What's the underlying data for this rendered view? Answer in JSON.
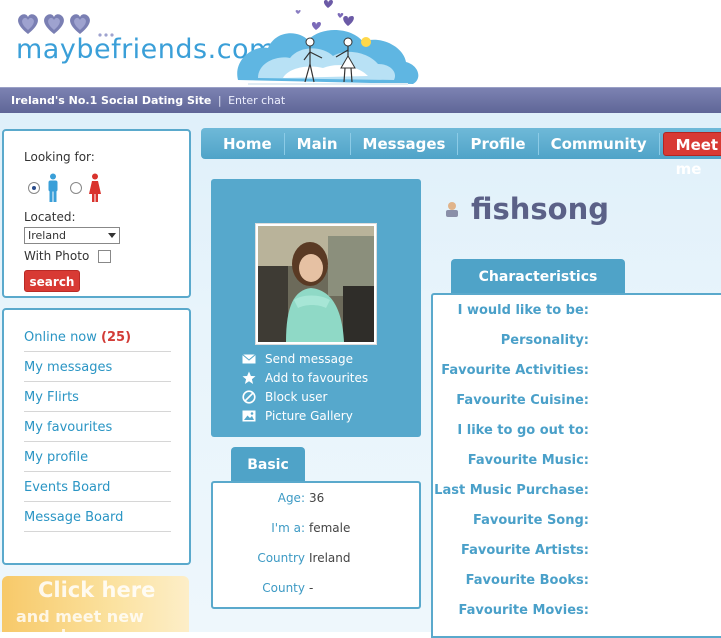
{
  "brand": {
    "logo_text": "maybefriends.com",
    "tagline": "Ireland's No.1 Social Dating Site",
    "separator": "|",
    "enter_chat": "Enter chat"
  },
  "search": {
    "looking_for_label": "Looking for:",
    "selected_gender": "male",
    "located_label": "Located:",
    "located_value": "Ireland",
    "with_photo_label": "With Photo",
    "with_photo_checked": false,
    "search_button": "search"
  },
  "menu": {
    "items": [
      {
        "label": "Online now",
        "count": "(25)"
      },
      {
        "label": "My messages"
      },
      {
        "label": "My Flirts"
      },
      {
        "label": "My favourites"
      },
      {
        "label": "My profile"
      },
      {
        "label": "Events Board"
      },
      {
        "label": "Message Board"
      }
    ]
  },
  "promo": {
    "line1": "Click here",
    "line2": "and meet new people"
  },
  "nav": {
    "items": [
      "Home",
      "Main",
      "Messages",
      "Profile",
      "Community"
    ],
    "meet_me": "Meet me"
  },
  "profile": {
    "username": "fishsong",
    "actions": [
      "Send message",
      "Add to favourites",
      "Block user",
      "Picture Gallery"
    ]
  },
  "basic": {
    "tab_label": "Basic",
    "rows": [
      {
        "key": "Age:",
        "value": "36"
      },
      {
        "key": "I'm a:",
        "value": "female"
      },
      {
        "key": "Country",
        "value": "Ireland"
      },
      {
        "key": "County",
        "value": "-"
      }
    ]
  },
  "characteristics": {
    "tab_label": "Characteristics",
    "fields": [
      "I would like to be:",
      "Personality:",
      "Favourite Activities:",
      "Favourite Cuisine:",
      "I like to go out to:",
      "Favourite Music:",
      "Last Music Purchase:",
      "Favourite Song:",
      "Favourite Artists:",
      "Favourite Books:",
      "Favourite Movies:"
    ]
  },
  "colors": {
    "accent_blue": "#4fa3c8",
    "brand_red": "#d83a34",
    "tagline_purple": "#6b71a3",
    "username": "#5b6187"
  },
  "icons": {
    "logo_hearts": "three-hearts-icon",
    "send_message": "envelope-icon",
    "add_favourite": "star-icon",
    "block_user": "block-icon",
    "picture_gallery": "picture-icon",
    "user_status": "user-icon"
  }
}
